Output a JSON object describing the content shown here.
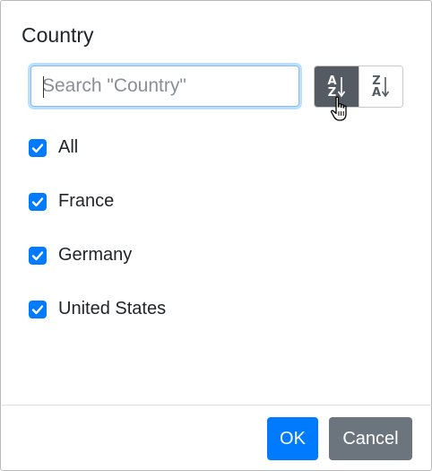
{
  "dialog": {
    "title": "Country",
    "search": {
      "placeholder": "Search \"Country\"",
      "value": ""
    },
    "sort": {
      "ascending": {
        "top": "A",
        "bottom": "Z",
        "icon": "sort-alpha-ascending-icon",
        "active": true
      },
      "descending": {
        "top": "Z",
        "bottom": "A",
        "icon": "sort-alpha-descending-icon",
        "active": false
      }
    },
    "items": [
      {
        "label": "All",
        "checked": true
      },
      {
        "label": "France",
        "checked": true
      },
      {
        "label": "Germany",
        "checked": true
      },
      {
        "label": "United States",
        "checked": true
      }
    ],
    "buttons": {
      "ok": "OK",
      "cancel": "Cancel"
    }
  },
  "colors": {
    "primary": "#007bff",
    "secondary": "#6c757d",
    "active_sort": "#545b62",
    "focus_border": "#80bdff"
  }
}
